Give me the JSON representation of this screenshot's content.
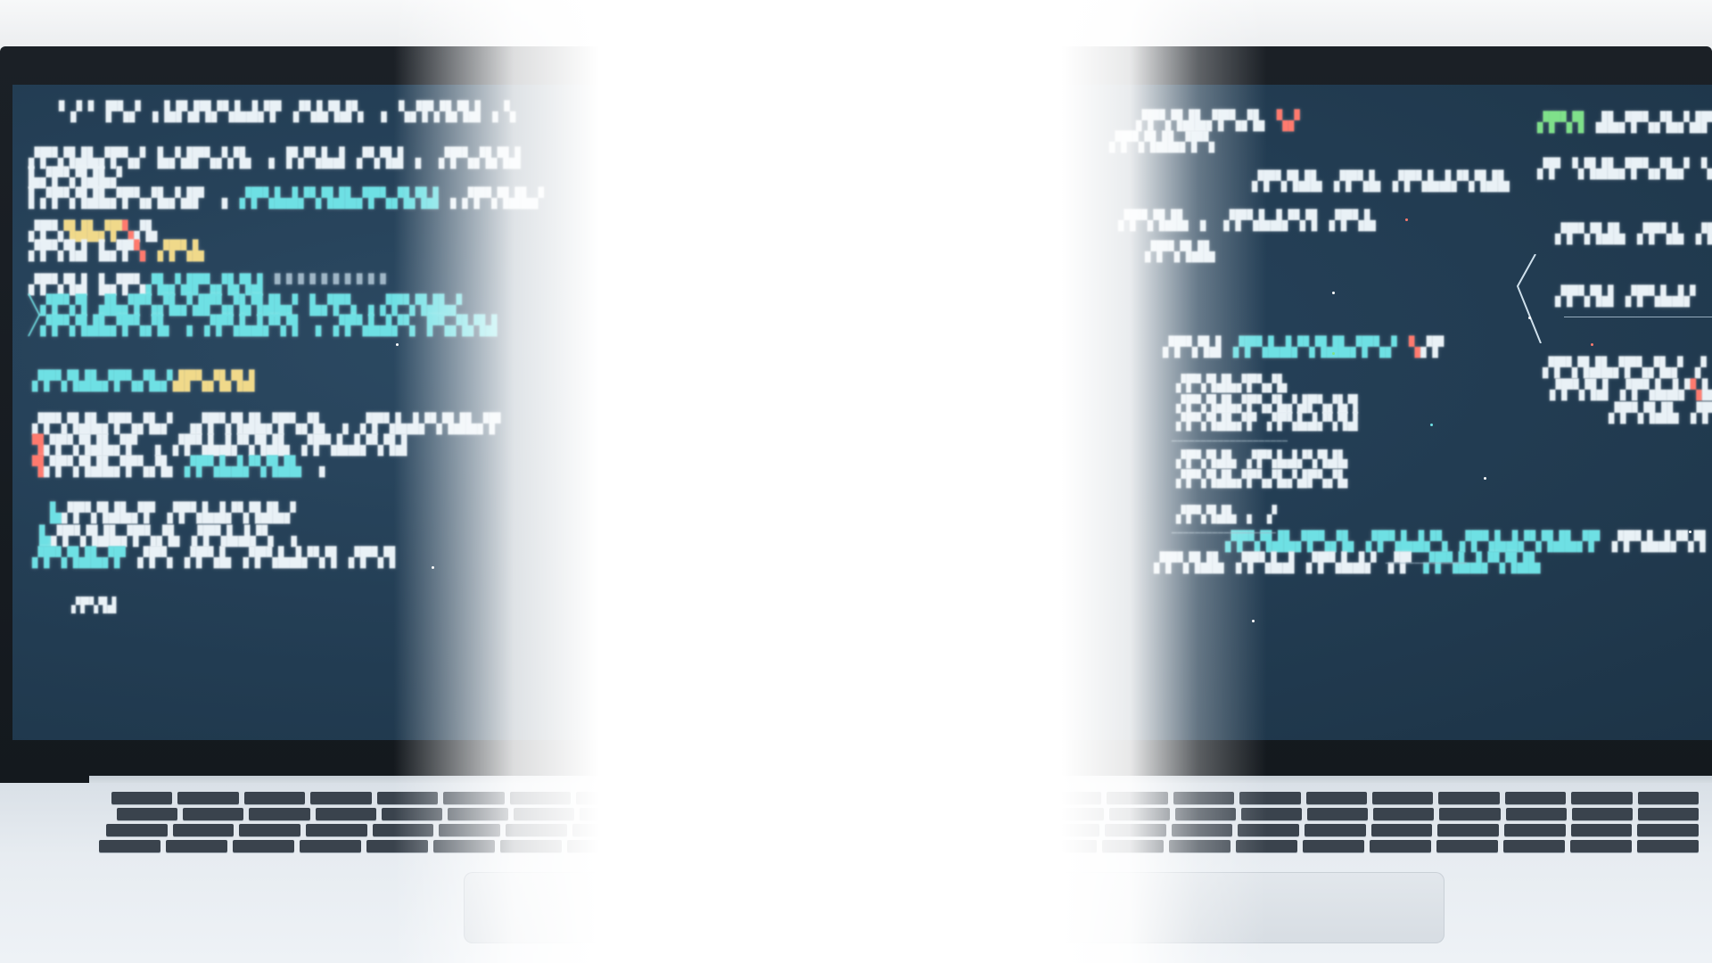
{
  "scene": {
    "description_colors": {
      "screen_bg": "#243f56",
      "text_primary": "#e9f1f6",
      "text_cyan": "#6ee0e4",
      "text_yellow": "#f0d98a",
      "text_red": "#ff7a6e",
      "text_green": "#7fe08a",
      "glare": "#ffffff"
    }
  },
  "screen": {
    "left_lines": [
      "",
      "",
      "",
      "",
      "",
      "",
      "",
      "",
      "",
      "",
      "",
      "",
      "",
      "",
      "",
      "",
      "",
      "",
      "",
      ""
    ],
    "right_lines": [
      "",
      "",
      "",
      "",
      "",
      "",
      "",
      "",
      "",
      "",
      "",
      "",
      "",
      "",
      "",
      "",
      "",
      "",
      "",
      "",
      "",
      "",
      "",
      "",
      ""
    ]
  }
}
